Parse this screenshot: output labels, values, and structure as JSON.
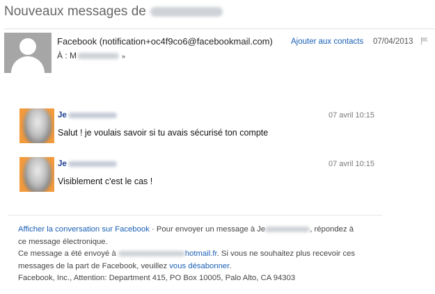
{
  "header": {
    "subject_prefix": "Nouveaux messages de"
  },
  "sender": {
    "name": "Facebook",
    "email_display": "(notification+oc4f9co6@facebookmail.com)",
    "add_contact": "Ajouter aux contacts",
    "date": "07/04/2013",
    "to_label": "À : M",
    "expand_glyph": "»"
  },
  "messages": [
    {
      "name_prefix": "Je",
      "time": "07 avril 10:15",
      "text": "Salut ! je voulais savoir si tu avais sécurisé ton compte"
    },
    {
      "name_prefix": "Je",
      "time": "07 avril 10:15",
      "text": "Visiblement c'est le cas !"
    }
  ],
  "footer": {
    "view_conversation_link": "Afficher la conversation sur Facebook",
    "line1_mid": " · Pour envoyer un message à Je",
    "line1_end": ", répondez à",
    "line2": "ce message électronique.",
    "line3_start": "Ce message a été envoyé à",
    "line3_email_end": "hotmail.fr",
    "line3_end": ". Si vous ne souhaitez plus recevoir ces",
    "line4_start": "messages de la part de Facebook, veuillez ",
    "unsubscribe_link": "vous désabonner",
    "line4_end": ".",
    "address": "Facebook, Inc., Attention: Department 415, PO Box 10005, Palo Alto, CA 94303"
  },
  "colors": {
    "link": "#1a5fb4",
    "name": "#1a3d8f",
    "avatar_bg": "#f29a3c"
  },
  "icons": {
    "flag": "flag-icon",
    "sender_avatar": "person-silhouette-icon"
  }
}
